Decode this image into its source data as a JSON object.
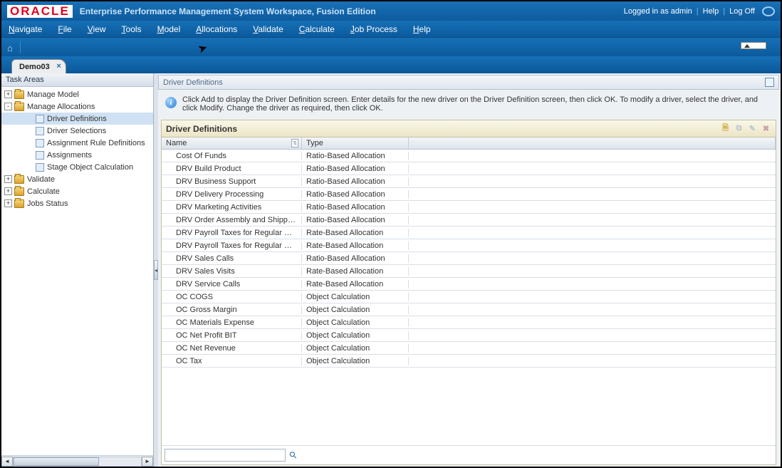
{
  "header": {
    "logo_text": "ORACLE",
    "app_title": "Enterprise Performance Management System Workspace, Fusion Edition",
    "logged_in": "Logged in as admin",
    "help": "Help",
    "logoff": "Log Off"
  },
  "menubar": {
    "items": [
      {
        "key": "N",
        "label": "avigate"
      },
      {
        "key": "F",
        "label": "ile"
      },
      {
        "key": "V",
        "label": "iew"
      },
      {
        "key": "T",
        "label": "ools"
      },
      {
        "key": "M",
        "label": "odel"
      },
      {
        "key": "A",
        "label": "llocations"
      },
      {
        "key": "V",
        "label": "alidate"
      },
      {
        "key": "C",
        "label": "alculate"
      },
      {
        "key": "J",
        "label": "ob Process"
      },
      {
        "key": "H",
        "label": "elp"
      }
    ]
  },
  "tab": {
    "label": "Demo03"
  },
  "sidebar": {
    "title": "Task Areas",
    "tree": [
      {
        "level": 0,
        "expander": "+",
        "icon": "folder",
        "label": "Manage Model"
      },
      {
        "level": 0,
        "expander": "-",
        "icon": "folder",
        "label": "Manage Allocations"
      },
      {
        "level": 1,
        "expander": "",
        "icon": "leaf",
        "label": "Driver Definitions",
        "selected": true
      },
      {
        "level": 1,
        "expander": "",
        "icon": "leaf",
        "label": "Driver Selections"
      },
      {
        "level": 1,
        "expander": "",
        "icon": "leaf",
        "label": "Assignment Rule Definitions"
      },
      {
        "level": 1,
        "expander": "",
        "icon": "leaf",
        "label": "Assignments"
      },
      {
        "level": 1,
        "expander": "",
        "icon": "leaf",
        "label": "Stage Object Calculation"
      },
      {
        "level": 0,
        "expander": "+",
        "icon": "folder",
        "label": "Validate"
      },
      {
        "level": 0,
        "expander": "+",
        "icon": "folder",
        "label": "Calculate"
      },
      {
        "level": 0,
        "expander": "+",
        "icon": "folder",
        "label": "Jobs Status"
      }
    ]
  },
  "panel": {
    "title": "Driver Definitions",
    "info_text": "Click Add to display the Driver Definition screen. Enter details for the new driver on the Driver Definition screen, then click OK. To modify a driver, select the driver, and click Modify. Change the driver as required, then click OK.",
    "section_title": "Driver Definitions",
    "columns": {
      "name": "Name",
      "type": "Type"
    },
    "rows": [
      {
        "name": "Cost Of Funds",
        "type": "Ratio-Based Allocation"
      },
      {
        "name": "DRV Build Product",
        "type": "Ratio-Based Allocation"
      },
      {
        "name": "DRV Business Support",
        "type": "Ratio-Based Allocation"
      },
      {
        "name": "DRV Delivery Processing",
        "type": "Ratio-Based Allocation"
      },
      {
        "name": "DRV Marketing Activities",
        "type": "Ratio-Based Allocation"
      },
      {
        "name": "DRV Order Assembly and Shipping",
        "type": "Ratio-Based Allocation"
      },
      {
        "name": "DRV Payroll Taxes for Regular Salary",
        "type": "Rate-Based Allocation"
      },
      {
        "name": "DRV Payroll Taxes for Regular Wa...",
        "type": "Rate-Based Allocation"
      },
      {
        "name": "DRV Sales Calls",
        "type": "Ratio-Based Allocation"
      },
      {
        "name": "DRV Sales Visits",
        "type": "Rate-Based Allocation"
      },
      {
        "name": "DRV Service Calls",
        "type": "Rate-Based Allocation"
      },
      {
        "name": "OC COGS",
        "type": "Object Calculation"
      },
      {
        "name": "OC Gross Margin",
        "type": "Object Calculation"
      },
      {
        "name": "OC Materials Expense",
        "type": "Object Calculation"
      },
      {
        "name": "OC Net Profit BIT",
        "type": "Object Calculation"
      },
      {
        "name": "OC Net Revenue",
        "type": "Object Calculation"
      },
      {
        "name": "OC Tax",
        "type": "Object Calculation"
      }
    ],
    "search_placeholder": ""
  }
}
